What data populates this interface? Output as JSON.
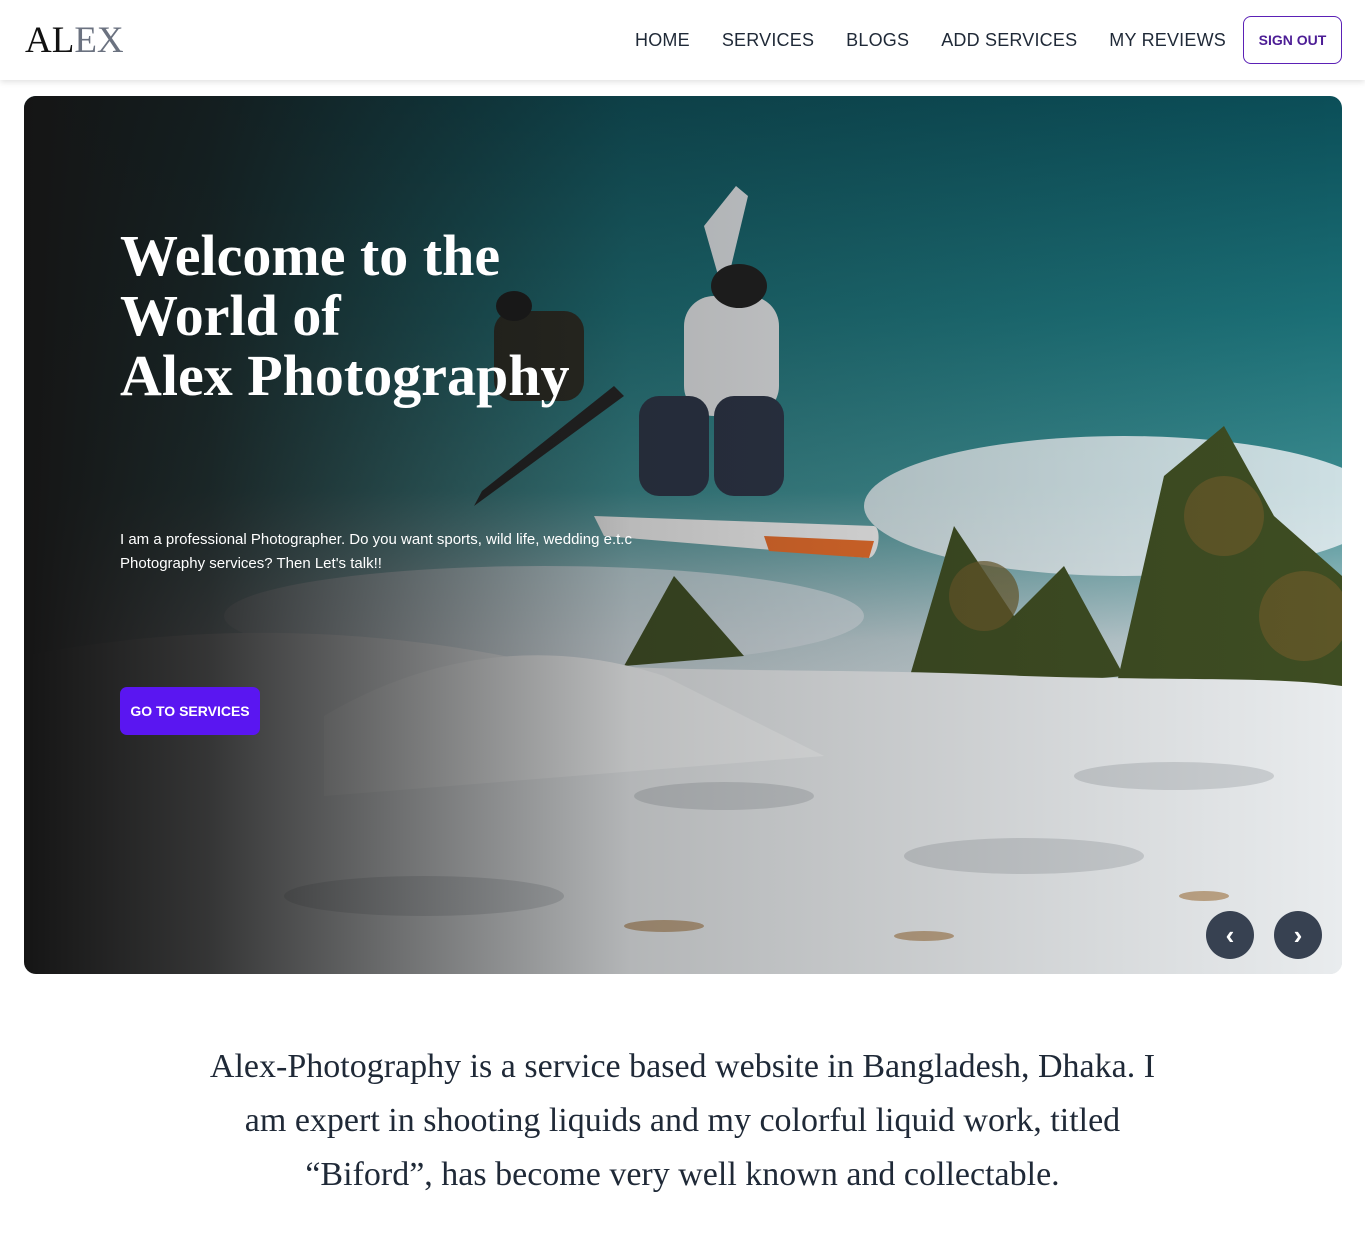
{
  "brand": {
    "part1": "AL",
    "part2": "EX"
  },
  "nav": {
    "items": [
      "HOME",
      "SERVICES",
      "BLOGS",
      "ADD SERVICES",
      "MY REVIEWS"
    ],
    "signout_label": "SIGN OUT"
  },
  "hero": {
    "title_lines": [
      "Welcome to the",
      "World of",
      "Alex Photography"
    ],
    "description": "I am a professional Photographer. Do you want sports, wild life, wedding e.t.c Photography services? Then Let's talk!!",
    "cta_label": "GO TO SERVICES",
    "prev_icon": "‹",
    "next_icon": "›"
  },
  "about": {
    "text": "Alex-Photography is a service based website in Bangladesh, Dhaka. I am expert in shooting liquids and my colorful liquid work, titled “Biford”, has become very well known and collectable."
  },
  "colors": {
    "accent": "#5a16f1",
    "signout_border": "#5b21b6",
    "arrow_bg": "#374151"
  }
}
